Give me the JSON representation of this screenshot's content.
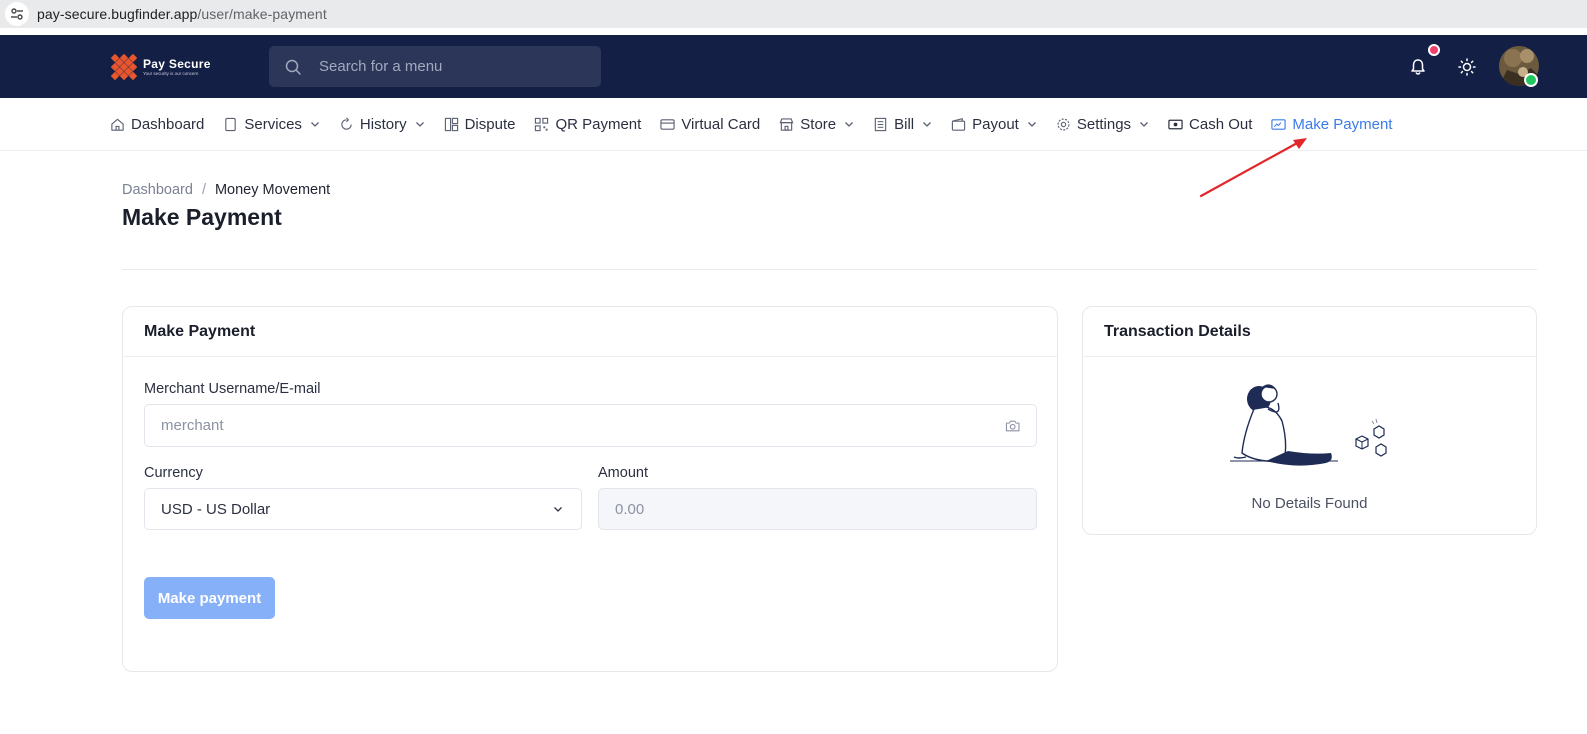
{
  "browser": {
    "url_domain": "pay-secure.bugfinder.app",
    "url_path": "/user/make-payment"
  },
  "header": {
    "logo_name": "Pay Secure",
    "logo_tagline": "Your security is our concern",
    "search_placeholder": "Search for a menu"
  },
  "nav": {
    "items": [
      {
        "label": "Dashboard",
        "icon": "home-icon",
        "dropdown": false
      },
      {
        "label": "Services",
        "icon": "file-icon",
        "dropdown": true
      },
      {
        "label": "History",
        "icon": "refresh-icon",
        "dropdown": true
      },
      {
        "label": "Dispute",
        "icon": "layout-icon",
        "dropdown": false
      },
      {
        "label": "QR Payment",
        "icon": "qr-code-icon",
        "dropdown": false
      },
      {
        "label": "Virtual Card",
        "icon": "credit-card-icon",
        "dropdown": false
      },
      {
        "label": "Store",
        "icon": "store-icon",
        "dropdown": true
      },
      {
        "label": "Bill",
        "icon": "receipt-icon",
        "dropdown": true
      },
      {
        "label": "Payout",
        "icon": "wallet-icon",
        "dropdown": true
      },
      {
        "label": "Settings",
        "icon": "gear-icon",
        "dropdown": true
      },
      {
        "label": "Cash Out",
        "icon": "cash-icon",
        "dropdown": false
      },
      {
        "label": "Make Payment",
        "icon": "payment-icon",
        "dropdown": false,
        "active": true
      }
    ]
  },
  "breadcrumb": {
    "parent": "Dashboard",
    "separator": "/",
    "current": "Money Movement"
  },
  "page": {
    "title": "Make Payment"
  },
  "payment_form": {
    "title": "Make Payment",
    "merchant_label": "Merchant Username/E-mail",
    "merchant_placeholder": "merchant",
    "currency_label": "Currency",
    "currency_value": "USD - US Dollar",
    "amount_label": "Amount",
    "amount_placeholder": "0.00",
    "submit_label": "Make payment"
  },
  "transaction_details": {
    "title": "Transaction Details",
    "empty_text": "No Details Found"
  },
  "colors": {
    "header_bg": "#131f44",
    "active_nav": "#3b7bea",
    "button_bg": "#86b0f8",
    "notification_dot": "#ef3f6c",
    "online_dot": "#22c55e",
    "annotation_arrow": "#e3262b"
  }
}
